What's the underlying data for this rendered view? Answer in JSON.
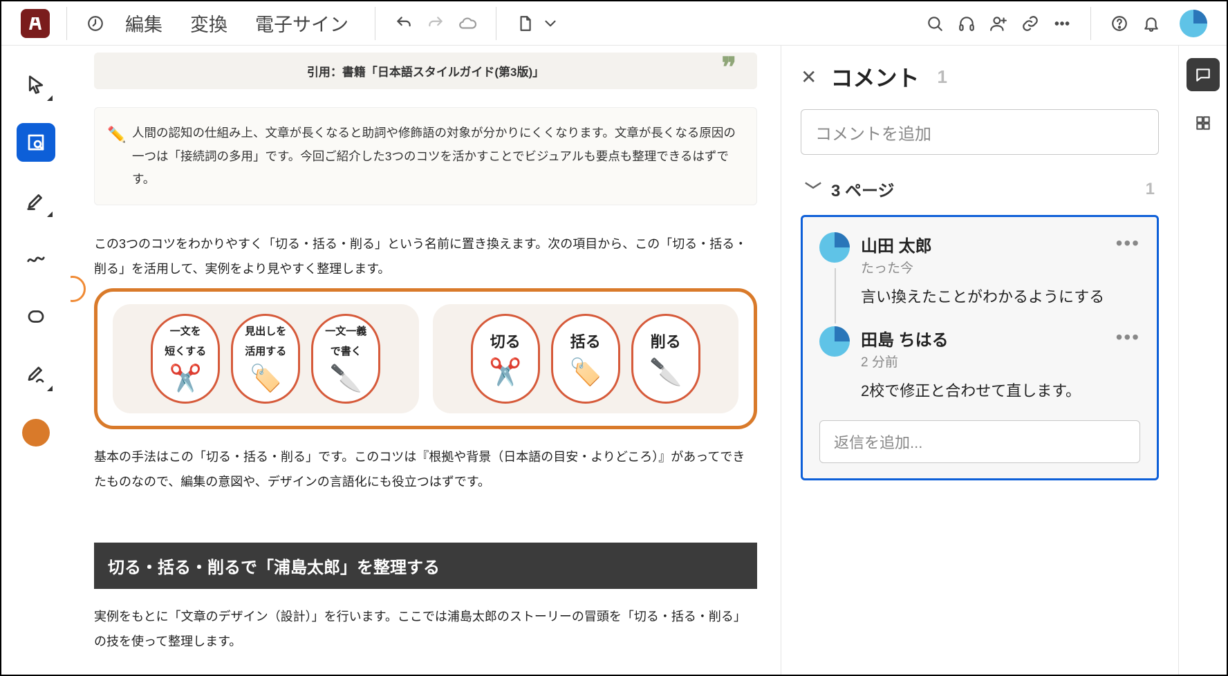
{
  "toolbar": {
    "menu": {
      "edit": "編集",
      "convert": "変換",
      "esign": "電子サイン"
    }
  },
  "document": {
    "quote_label": "引用：書籍「日本語スタイルガイド(第3版)」",
    "note_text": "人間の認知の仕組み上、文章が長くなると助詞や修飾語の対象が分かりにくくなります。文章が長くなる原因の一つは「接続詞の多用」です。今回ご紹介した3つのコツを活かすことでビジュアルも要点も整理できるはずです。",
    "intro_text": "この3つのコツをわかりやすく「切る・括る・削る」という名前に置き換えます。次の項目から、この「切る・括る・削る」を活用して、実例をより見やすく整理します。",
    "ovals_a": [
      {
        "l1": "一文を",
        "l2": "短くする"
      },
      {
        "l1": "見出しを",
        "l2": "活用する"
      },
      {
        "l1": "一文一義",
        "l2": "で書く"
      }
    ],
    "ovals_b": [
      {
        "big": "切る"
      },
      {
        "big": "括る"
      },
      {
        "big": "削る"
      }
    ],
    "followup_text": "基本の手法はこの「切る・括る・削る」です。このコツは『根拠や背景（日本語の目安・よりどころ）』があってできたものなので、編集の意図や、デザインの言語化にも役立つはずです。",
    "section_title": "切る・括る・削るで「浦島太郎」を整理する",
    "section_para": "実例をもとに「文章のデザイン（設計）」を行います。ここでは浦島太郎のストーリーの冒頭を「切る・括る・削る」の技を使って整理します。"
  },
  "comments": {
    "title": "コメント",
    "total": "1",
    "add_placeholder": "コメントを追加",
    "page_label": "3 ページ",
    "page_count": "1",
    "reply_placeholder": "返信を追加...",
    "items": [
      {
        "name": "山田 太郎",
        "time": "たった今",
        "text": "言い換えたことがわかるようにする"
      },
      {
        "name": "田島 ちはる",
        "time": "2 分前",
        "text": "2校で修正と合わせて直します。"
      }
    ]
  }
}
